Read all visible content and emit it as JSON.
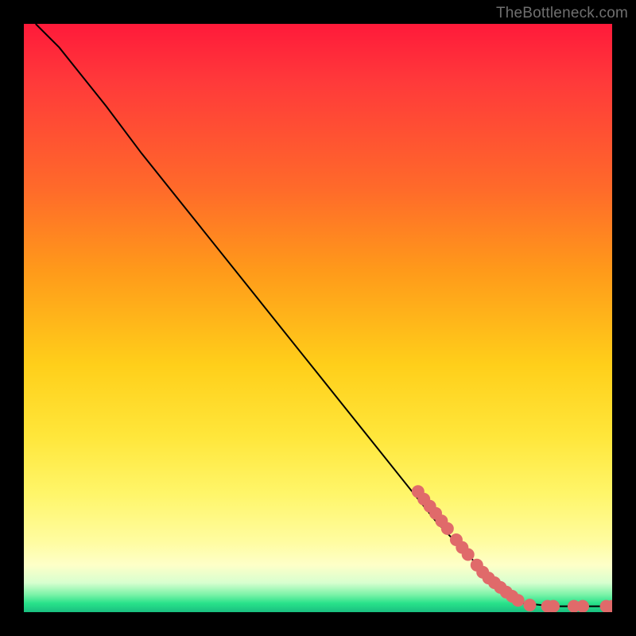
{
  "watermark": "TheBottleneck.com",
  "chart_data": {
    "type": "line",
    "title": "",
    "xlabel": "",
    "ylabel": "",
    "xlim": [
      0,
      100
    ],
    "ylim": [
      0,
      100
    ],
    "curve": [
      {
        "x": 2,
        "y": 100
      },
      {
        "x": 6,
        "y": 96
      },
      {
        "x": 10,
        "y": 91
      },
      {
        "x": 14,
        "y": 86
      },
      {
        "x": 20,
        "y": 78
      },
      {
        "x": 30,
        "y": 65.5
      },
      {
        "x": 40,
        "y": 53
      },
      {
        "x": 50,
        "y": 40.5
      },
      {
        "x": 60,
        "y": 28
      },
      {
        "x": 70,
        "y": 15.5
      },
      {
        "x": 80,
        "y": 5
      },
      {
        "x": 85,
        "y": 1.5
      },
      {
        "x": 90,
        "y": 1
      },
      {
        "x": 95,
        "y": 1
      },
      {
        "x": 100,
        "y": 1
      }
    ],
    "markers": [
      {
        "x": 67,
        "y": 20.5
      },
      {
        "x": 68,
        "y": 19.2
      },
      {
        "x": 69,
        "y": 18.0
      },
      {
        "x": 70,
        "y": 16.8
      },
      {
        "x": 71,
        "y": 15.5
      },
      {
        "x": 72,
        "y": 14.2
      },
      {
        "x": 73.5,
        "y": 12.3
      },
      {
        "x": 74.5,
        "y": 11.0
      },
      {
        "x": 75.5,
        "y": 9.8
      },
      {
        "x": 77,
        "y": 8.0
      },
      {
        "x": 78,
        "y": 6.8
      },
      {
        "x": 79,
        "y": 5.8
      },
      {
        "x": 80,
        "y": 5.0
      },
      {
        "x": 81,
        "y": 4.2
      },
      {
        "x": 82,
        "y": 3.4
      },
      {
        "x": 83,
        "y": 2.7
      },
      {
        "x": 84,
        "y": 2.0
      },
      {
        "x": 86,
        "y": 1.2
      },
      {
        "x": 89,
        "y": 1.0
      },
      {
        "x": 90,
        "y": 1.0
      },
      {
        "x": 93.5,
        "y": 1.0
      },
      {
        "x": 95,
        "y": 1.0
      },
      {
        "x": 99,
        "y": 1.0
      },
      {
        "x": 100,
        "y": 1.0
      }
    ],
    "marker_color": "#e06a6a",
    "marker_radius_px": 8,
    "gradient_stops": [
      {
        "pos": 0.0,
        "color": "#ff1a3a"
      },
      {
        "pos": 0.28,
        "color": "#ff6a2a"
      },
      {
        "pos": 0.58,
        "color": "#ffcf1a"
      },
      {
        "pos": 0.88,
        "color": "#fffca0"
      },
      {
        "pos": 0.97,
        "color": "#7cf3a8"
      },
      {
        "pos": 1.0,
        "color": "#1abf80"
      }
    ]
  }
}
